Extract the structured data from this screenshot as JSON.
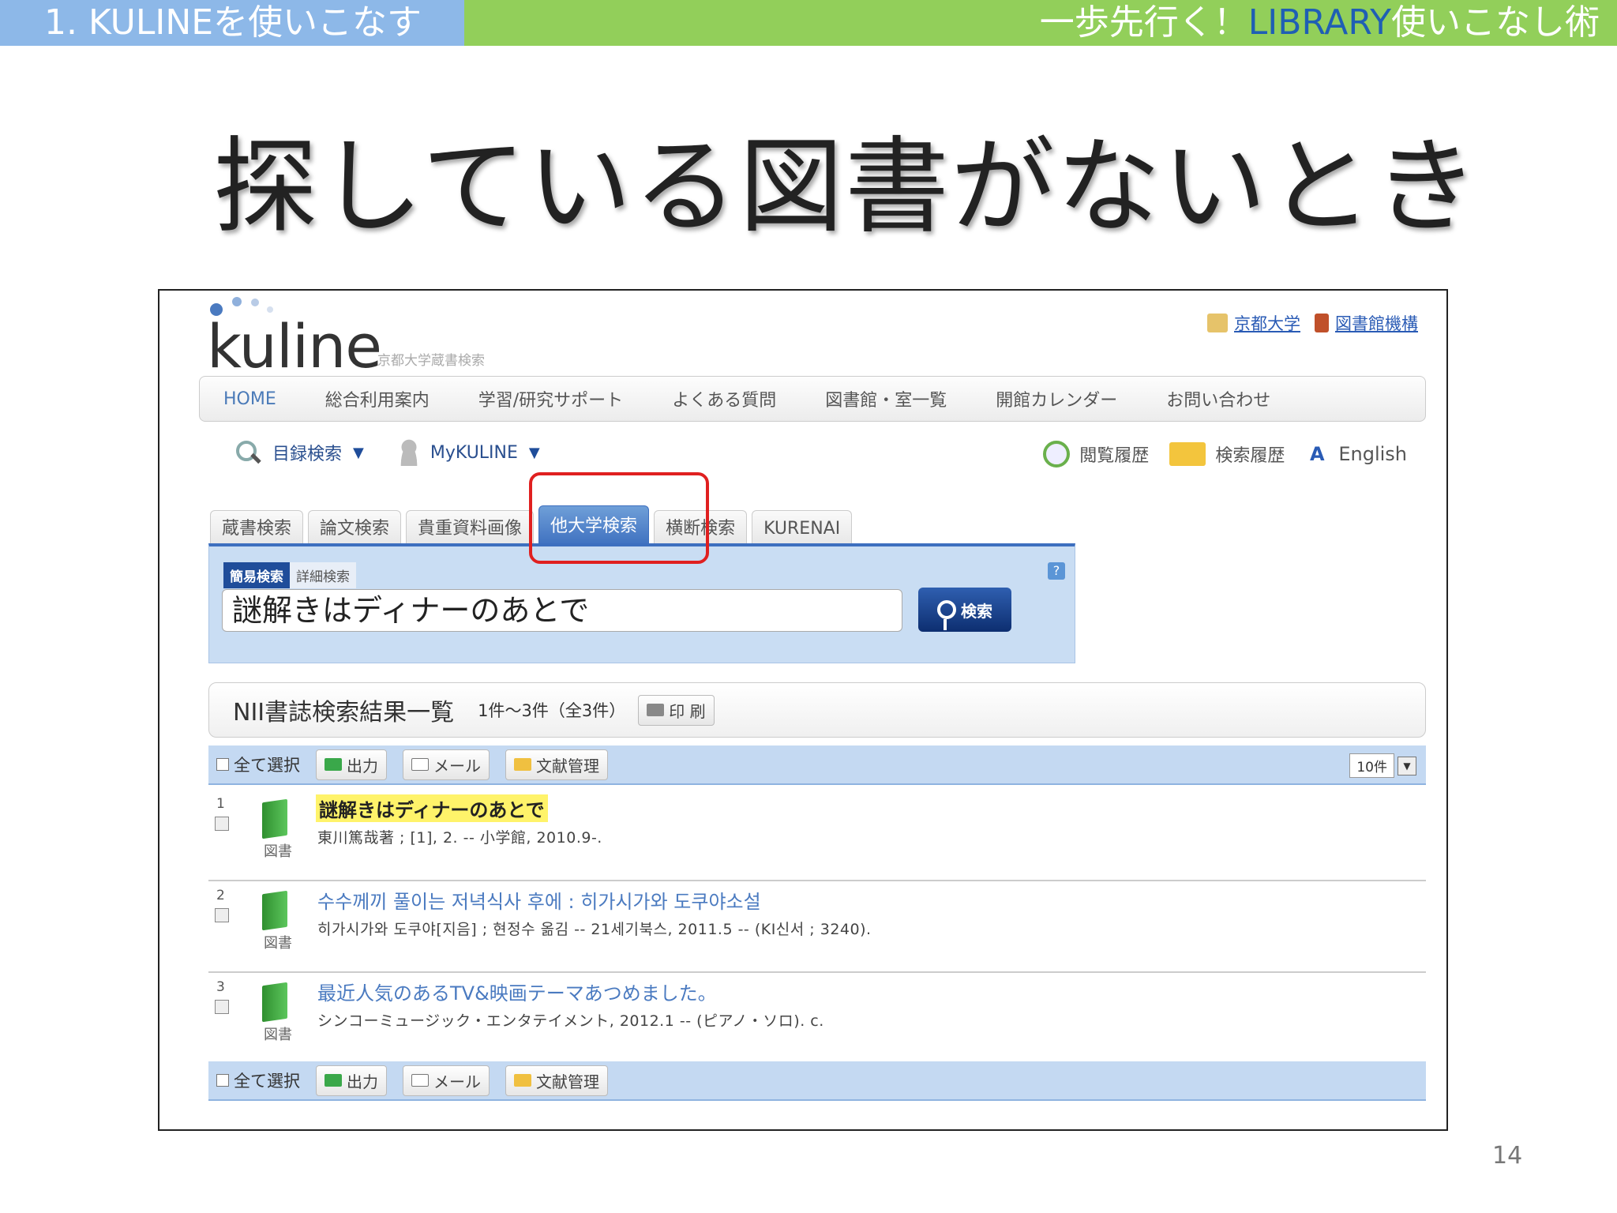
{
  "banner": {
    "left": "1. KULINEを使いこなす",
    "right_prefix": "一歩先行く！",
    "right_highlight": "LIBRARY",
    "right_suffix": "使いこなし術"
  },
  "slide": {
    "title": "探している図書がないとき",
    "page_number": "14"
  },
  "app": {
    "logo": "kuline",
    "logo_sub": "京都大学蔵書検索",
    "top_links": [
      "京都大学",
      "図書館機構"
    ],
    "nav": [
      "HOME",
      "総合利用案内",
      "学習/研究サポート",
      "よくある質問",
      "図書館・室一覧",
      "開館カレンダー",
      "お問い合わせ"
    ],
    "catalog_search": "目録検索",
    "my_kuline": "MyKULINE",
    "view_history": "閲覧履歴",
    "search_history": "検索履歴",
    "english": "English",
    "tabs": [
      "蔵書検索",
      "論文検索",
      "貴重資料画像",
      "他大学検索",
      "横断検索",
      "KURENAI"
    ],
    "active_tab": "他大学検索",
    "mode_simple": "簡易検索",
    "mode_detail": "詳細検索",
    "help": "?",
    "query": "謎解きはディナーのあとで",
    "search_button": "検索",
    "result_title": "NII書誌検索結果一覧",
    "result_count": "1件～3件（全3件）",
    "print": "印 刷",
    "select_all": "全て選択",
    "output": "出力",
    "mail": "メール",
    "refmgmt": "文献管理",
    "per_page": "10件",
    "records": [
      {
        "num": "1",
        "type": "図書",
        "title": "謎解きはディナーのあとで",
        "meta": "東川篤哉著 ; [1], 2. -- 小学館, 2010.9-."
      },
      {
        "num": "2",
        "type": "図書",
        "title": "수수께끼 풀이는 저녁식사 후에 : 히가시가와 도쿠야소설",
        "meta": "히가시가와 도쿠야[지음] ; 현정수 옮김 -- 21세기북스, 2011.5 -- (KI신서 ; 3240)."
      },
      {
        "num": "3",
        "type": "図書",
        "title": "最近人気のあるTV&映画テーマあつめました。",
        "meta": "シンコーミュージック・エンタテイメント, 2012.1 -- (ピアノ・ソロ). c."
      }
    ]
  },
  "colors": {
    "banner_left": "#8db8e8",
    "banner_right": "#92cf5a",
    "highlight_box": "#e02020",
    "active_tab": "#3d6fbf"
  }
}
